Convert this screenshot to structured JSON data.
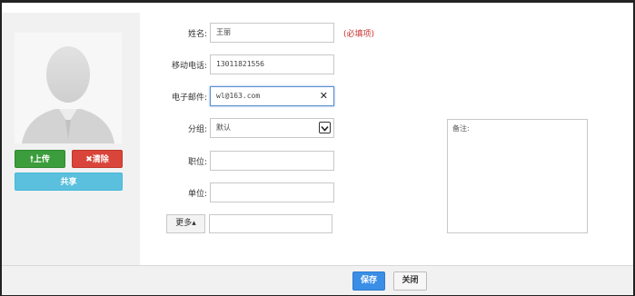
{
  "photo": {
    "upload_label": "上传",
    "clear_label": "清除",
    "share_label": "共享",
    "upload_icon": "arrow-up-icon",
    "clear_icon": "close-icon"
  },
  "form": {
    "name_label": "姓名:",
    "name_value": "王丽",
    "required_note": "(必填项)",
    "mobile_label": "移动电话:",
    "mobile_value": "13011821556",
    "email_label": "电子邮件:",
    "email_value": "wl@163.com",
    "group_label": "分组:",
    "group_value": "默认",
    "position_label": "职位:",
    "position_value": "",
    "company_label": "单位:",
    "company_value": "",
    "more_label": "更多▴",
    "more_value": ""
  },
  "notes": {
    "label": "备注:"
  },
  "footer": {
    "save_label": "保存",
    "close_label": "关闭"
  },
  "colors": {
    "upload": "#3b9d3b",
    "clear": "#d9453a",
    "share": "#5bc0de",
    "save": "#3a8ee6",
    "required": "#c9302c"
  }
}
